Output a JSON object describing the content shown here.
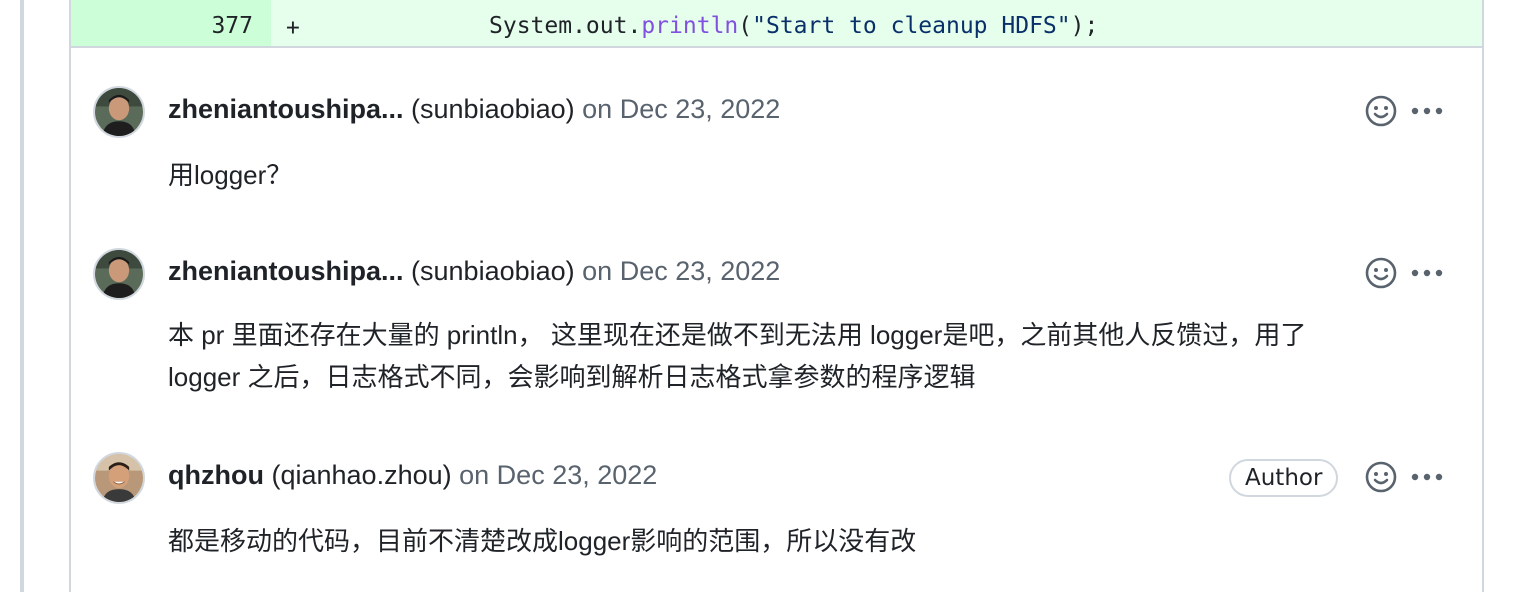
{
  "diff": {
    "line_number": "377",
    "marker": "+",
    "code_prefix": "System.out.",
    "code_method": "println",
    "code_open": "(",
    "code_string": "\"Start to cleanup HDFS\"",
    "code_close": ");"
  },
  "comments": [
    {
      "login": "zheniantoushipa...",
      "name": "(sunbiaobiao)",
      "date": "on Dec 23, 2022",
      "body": [
        "用logger？"
      ]
    },
    {
      "login": "zheniantoushipa...",
      "name": "(sunbiaobiao)",
      "date": "on Dec 23, 2022",
      "body": [
        "本 pr 里面还存在大量的 println， 这里现在还是做不到无法用 logger是吧，之前其他人反馈过，用了",
        "logger 之后，日志格式不同，会影响到解析日志格式拿参数的程序逻辑"
      ]
    },
    {
      "login": "qhzhou",
      "name": "(qianhao.zhou)",
      "date": "on Dec 23, 2022",
      "badge": "Author",
      "body": [
        "都是移动的代码，目前不清楚改成logger影响的范围，所以没有改"
      ]
    }
  ],
  "icons": {
    "reaction": "smiley-icon",
    "menu": "kebab-horizontal-icon"
  },
  "colors": {
    "addition_bg": "#e6ffec",
    "addition_num_bg": "#ccffd8",
    "muted_text": "#59636e",
    "border": "#d0d7de"
  }
}
